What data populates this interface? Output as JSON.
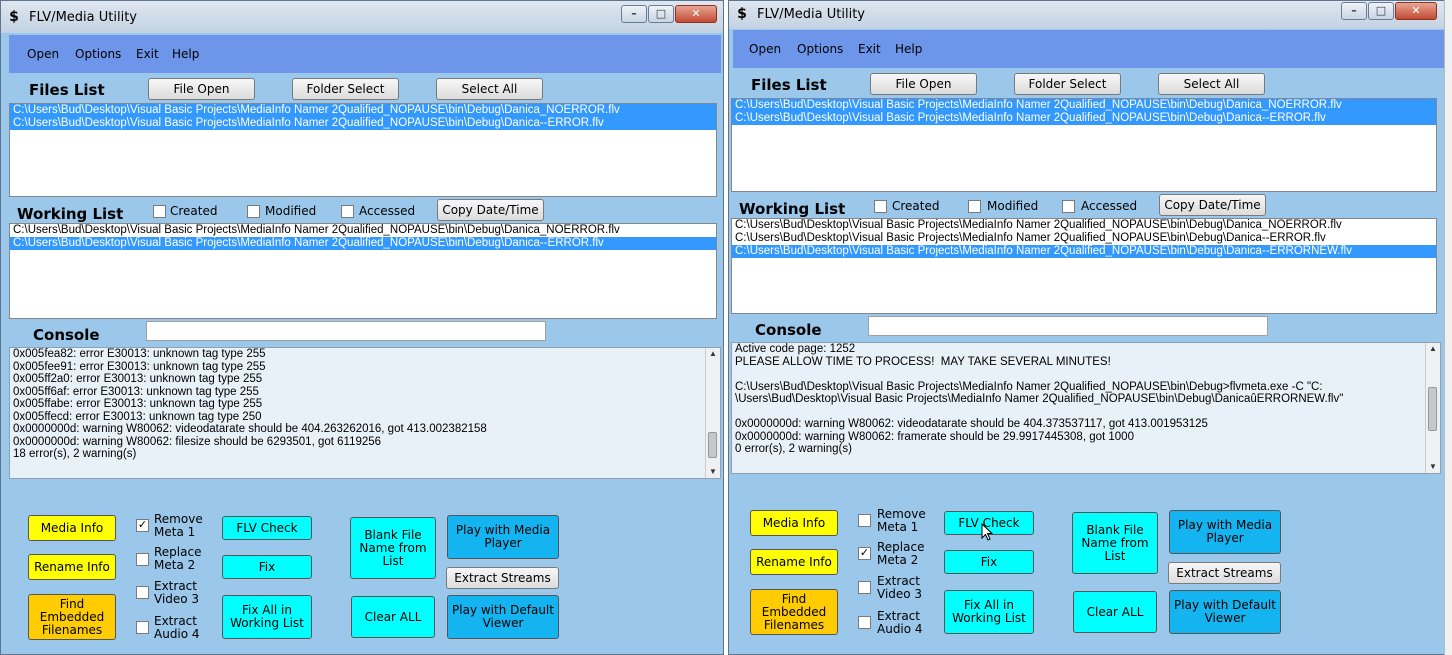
{
  "windows": [
    {
      "title": "FLV/Media Utility",
      "menu": [
        "Open",
        "Options",
        "Exit",
        "Help"
      ],
      "files_list": {
        "label": "Files List",
        "buttons": [
          "File Open",
          "Folder Select",
          "Select All"
        ],
        "items": [
          {
            "text": "C:\\Users\\Bud\\Desktop\\Visual Basic Projects\\MediaInfo Namer 2Qualified_NOPAUSE\\bin\\Debug\\Danica_NOERROR.flv",
            "selected": true
          },
          {
            "text": "C:\\Users\\Bud\\Desktop\\Visual Basic Projects\\MediaInfo Namer 2Qualified_NOPAUSE\\bin\\Debug\\Danica--ERROR.flv",
            "selected": true
          }
        ]
      },
      "working_list": {
        "label": "Working List",
        "checkboxes": [
          {
            "label": "Created",
            "checked": false
          },
          {
            "label": "Modified",
            "checked": false
          },
          {
            "label": "Accessed",
            "checked": false
          }
        ],
        "copy_button": "Copy Date/Time",
        "items": [
          {
            "text": "C:\\Users\\Bud\\Desktop\\Visual Basic Projects\\MediaInfo Namer 2Qualified_NOPAUSE\\bin\\Debug\\Danica_NOERROR.flv",
            "selected": false
          },
          {
            "text": "C:\\Users\\Bud\\Desktop\\Visual Basic Projects\\MediaInfo Namer 2Qualified_NOPAUSE\\bin\\Debug\\Danica--ERROR.flv",
            "selected": true
          }
        ]
      },
      "console": {
        "label": "Console",
        "input_value": "",
        "lines": [
          "0x005fea82: error E30013: unknown tag type 255",
          "0x005fee91: error E30013: unknown tag type 255",
          "0x005ff2a0: error E30013: unknown tag type 255",
          "0x005ff6af: error E30013: unknown tag type 255",
          "0x005ffabe: error E30013: unknown tag type 255",
          "0x005ffecd: error E30013: unknown tag type 250",
          "0x0000000d: warning W80062: videodatarate should be 404.263262016, got 413.002382158",
          "0x0000000d: warning W80062: filesize should be 6293501, got 6119256",
          "18 error(s), 2 warning(s)"
        ]
      },
      "actions": {
        "media_info": "Media Info",
        "rename_info": "Rename Info",
        "find_embedded": "Find Embedded Filenames",
        "options": [
          {
            "label": "Remove Meta  1",
            "checked": true
          },
          {
            "label": "Replace Meta  2",
            "checked": false
          },
          {
            "label": "Extract Video 3",
            "checked": false
          },
          {
            "label": "Extract Audio 4",
            "checked": false
          }
        ],
        "flv_check": "FLV Check",
        "fix": "Fix",
        "fix_all": "Fix All in Working List",
        "blank_file": "Blank File Name from List",
        "clear_all": "Clear ALL",
        "play_media_player": "Play with Media Player",
        "extract_streams": "Extract Streams",
        "play_default": "Play with Default Viewer"
      }
    },
    {
      "title": "FLV/Media Utility",
      "menu": [
        "Open",
        "Options",
        "Exit",
        "Help"
      ],
      "files_list": {
        "label": "Files List",
        "buttons": [
          "File Open",
          "Folder Select",
          "Select All"
        ],
        "items": [
          {
            "text": "C:\\Users\\Bud\\Desktop\\Visual Basic Projects\\MediaInfo Namer 2Qualified_NOPAUSE\\bin\\Debug\\Danica_NOERROR.flv",
            "selected": true
          },
          {
            "text": "C:\\Users\\Bud\\Desktop\\Visual Basic Projects\\MediaInfo Namer 2Qualified_NOPAUSE\\bin\\Debug\\Danica--ERROR.flv",
            "selected": true
          }
        ]
      },
      "working_list": {
        "label": "Working List",
        "checkboxes": [
          {
            "label": "Created",
            "checked": false
          },
          {
            "label": "Modified",
            "checked": false
          },
          {
            "label": "Accessed",
            "checked": false
          }
        ],
        "copy_button": "Copy Date/Time",
        "items": [
          {
            "text": "C:\\Users\\Bud\\Desktop\\Visual Basic Projects\\MediaInfo Namer 2Qualified_NOPAUSE\\bin\\Debug\\Danica_NOERROR.flv",
            "selected": false
          },
          {
            "text": "C:\\Users\\Bud\\Desktop\\Visual Basic Projects\\MediaInfo Namer 2Qualified_NOPAUSE\\bin\\Debug\\Danica--ERROR.flv",
            "selected": false
          },
          {
            "text": "C:\\Users\\Bud\\Desktop\\Visual Basic Projects\\MediaInfo Namer 2Qualified_NOPAUSE\\bin\\Debug\\Danica--ERRORNEW.flv",
            "selected": true
          }
        ]
      },
      "console": {
        "label": "Console",
        "input_value": "",
        "lines": [
          "Active code page: 1252",
          "PLEASE ALLOW TIME TO PROCESS!  MAY TAKE SEVERAL MINUTES!",
          "",
          "C:\\Users\\Bud\\Desktop\\Visual Basic Projects\\MediaInfo Namer 2Qualified_NOPAUSE\\bin\\Debug>flvmeta.exe -C \"C:",
          "\\Users\\Bud\\Desktop\\Visual Basic Projects\\MediaInfo Namer 2Qualified_NOPAUSE\\bin\\Debug\\DanicaûERRORNEW.flv\"",
          "",
          "0x0000000d: warning W80062: videodatarate should be 404.373537117, got 413.001953125",
          "0x0000000d: warning W80062: framerate should be 29.9917445308, got 1000",
          "0 error(s), 2 warning(s)"
        ]
      },
      "actions": {
        "media_info": "Media Info",
        "rename_info": "Rename Info",
        "find_embedded": "Find Embedded Filenames",
        "options": [
          {
            "label": "Remove Meta  1",
            "checked": false
          },
          {
            "label": "Replace Meta  2",
            "checked": true
          },
          {
            "label": "Extract Video 3",
            "checked": false
          },
          {
            "label": "Extract Audio 4",
            "checked": false
          }
        ],
        "flv_check": "FLV Check",
        "fix": "Fix",
        "fix_all": "Fix All in Working List",
        "blank_file": "Blank File Name from List",
        "clear_all": "Clear ALL",
        "play_media_player": "Play with Media Player",
        "extract_streams": "Extract Streams",
        "play_default": "Play with Default Viewer"
      }
    }
  ],
  "colors": {
    "window_bg": "#9ac7ea",
    "menubar": "#6d96ea",
    "selection": "#3399ff",
    "yellow_button": "#ffff00",
    "gold_button": "#ffcc00",
    "cyan_button": "#00ffff",
    "blue_button": "#14b4f0"
  },
  "icons": {
    "app": "dollar-sign-icon",
    "minimize": "minimize-icon",
    "maximize": "maximize-icon",
    "close": "close-icon"
  }
}
